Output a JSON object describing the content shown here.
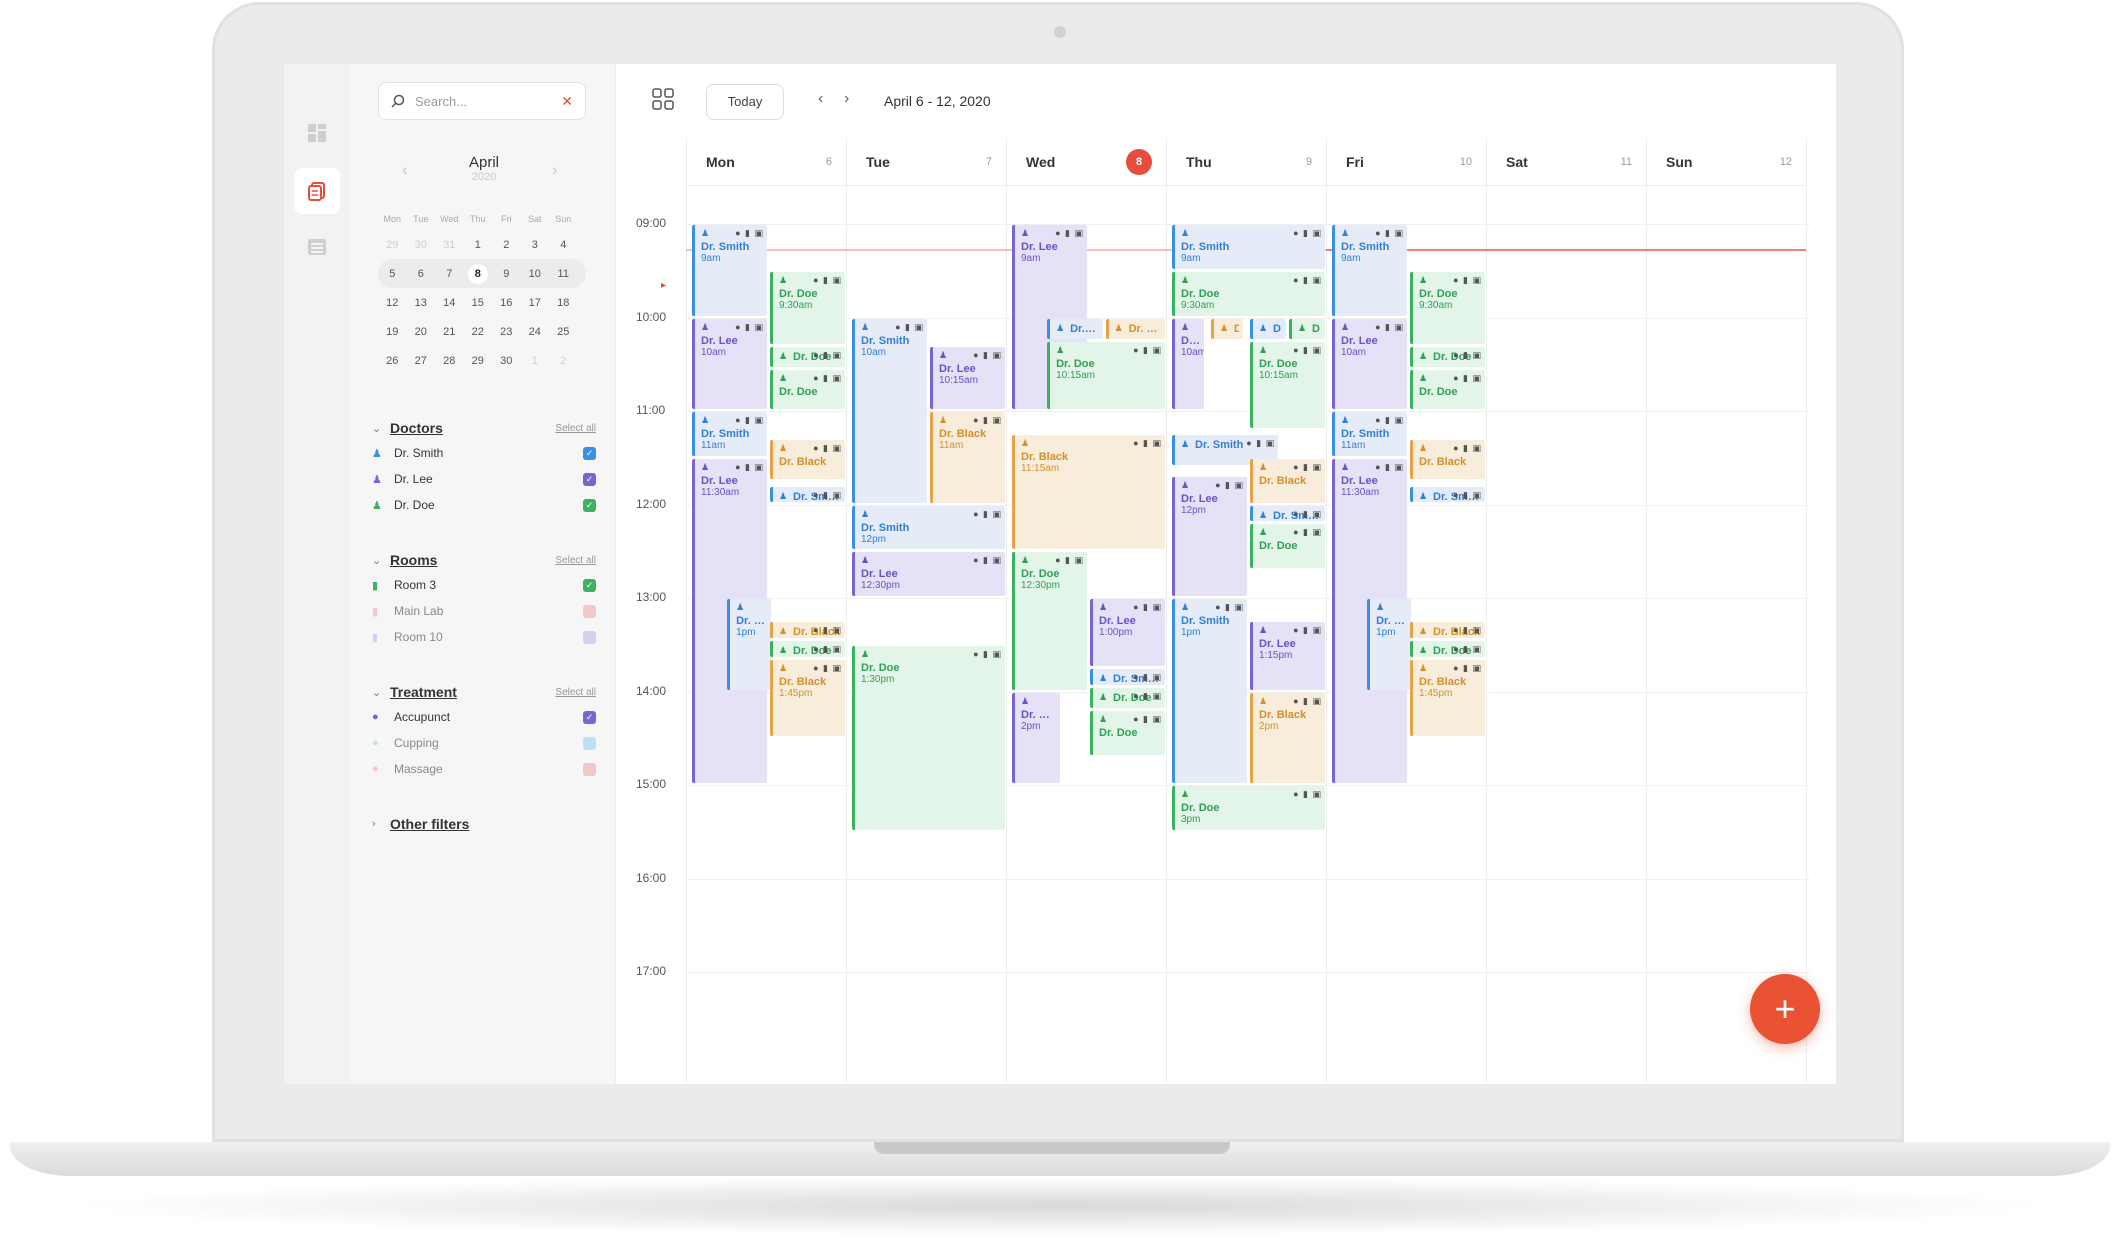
{
  "search": {
    "placeholder": "Search..."
  },
  "mini_calendar": {
    "month": "April",
    "year": "2020",
    "dow": [
      "Mon",
      "Tue",
      "Wed",
      "Thu",
      "Fri",
      "Sat",
      "Sun"
    ],
    "weeks": [
      [
        "29",
        "30",
        "31",
        "1",
        "2",
        "3",
        "4"
      ],
      [
        "5",
        "6",
        "7",
        "8",
        "9",
        "10",
        "11"
      ],
      [
        "12",
        "13",
        "14",
        "15",
        "16",
        "17",
        "18"
      ],
      [
        "19",
        "20",
        "21",
        "22",
        "23",
        "24",
        "25"
      ],
      [
        "26",
        "27",
        "28",
        "29",
        "30",
        "1",
        "2"
      ]
    ]
  },
  "filters": {
    "doctors": {
      "title": "Doctors",
      "action": "Select all",
      "items": [
        {
          "label": "Dr. Smith",
          "color": "#3a8ee6",
          "checked": true
        },
        {
          "label": "Dr. Lee",
          "color": "#7a63d2",
          "checked": true
        },
        {
          "label": "Dr. Doe",
          "color": "#3bb35e",
          "checked": true
        }
      ]
    },
    "rooms": {
      "title": "Rooms",
      "action": "Select all",
      "items": [
        {
          "label": "Room 3",
          "color": "#3bb35e",
          "checked": true
        },
        {
          "label": "Main Lab",
          "color": "#f2c7c7",
          "checked": false
        },
        {
          "label": "Room 10",
          "color": "#d6d0f0",
          "checked": false
        }
      ]
    },
    "treatment": {
      "title": "Treatment",
      "action": "Select all",
      "items": [
        {
          "label": "Accupunct",
          "color": "#7a63d2",
          "checked": true
        },
        {
          "label": "Cupping",
          "color": "#bfe0f2",
          "checked": false
        },
        {
          "label": "Massage",
          "color": "#f2c7c7",
          "checked": false
        }
      ]
    },
    "other": {
      "title": "Other filters"
    }
  },
  "toolbar": {
    "today_label": "Today",
    "range": "April 6 - 12, 2020"
  },
  "week": {
    "days": [
      {
        "name": "Mon",
        "num": "6"
      },
      {
        "name": "Tue",
        "num": "7"
      },
      {
        "name": "Wed",
        "num": "8",
        "today": true
      },
      {
        "name": "Thu",
        "num": "9"
      },
      {
        "name": "Fri",
        "num": "10"
      },
      {
        "name": "Sat",
        "num": "11"
      },
      {
        "name": "Sun",
        "num": "12"
      }
    ],
    "times": [
      "09:00",
      "10:00",
      "11:00",
      "12:00",
      "13:00",
      "14:00",
      "15:00",
      "16:00",
      "17:00"
    ]
  },
  "events": [
    {
      "day": 0,
      "col": 0,
      "cols": 1,
      "start": 9.0,
      "end": 10.0,
      "who": "Dr. Smith",
      "when": "9am",
      "color": "blue"
    },
    {
      "day": 0,
      "col": 1,
      "cols": 1,
      "start": 9.5,
      "end": 10.3,
      "who": "Dr. Doe",
      "when": "9:30am",
      "color": "green"
    },
    {
      "day": 0,
      "col": 0,
      "cols": 1,
      "start": 10.0,
      "end": 11.0,
      "who": "Dr. Lee",
      "when": "10am",
      "color": "purple"
    },
    {
      "day": 0,
      "col": 1,
      "cols": 1,
      "start": 10.3,
      "end": 10.55,
      "who": "Dr. Doe",
      "when": "",
      "color": "green"
    },
    {
      "day": 0,
      "col": 1,
      "cols": 1,
      "start": 10.55,
      "end": 11.0,
      "who": "Dr. Doe",
      "when": "",
      "color": "green"
    },
    {
      "day": 0,
      "col": 0,
      "cols": 1,
      "start": 11.0,
      "end": 11.5,
      "who": "Dr. Smith",
      "when": "11am",
      "color": "blue"
    },
    {
      "day": 0,
      "col": 1,
      "cols": 1,
      "start": 11.3,
      "end": 11.75,
      "who": "Dr. Black",
      "when": "",
      "color": "orange"
    },
    {
      "day": 0,
      "col": 0,
      "cols": 1,
      "start": 11.5,
      "end": 15.0,
      "who": "Dr. Lee",
      "when": "11:30am",
      "color": "purple"
    },
    {
      "day": 0,
      "col": 1,
      "cols": 1,
      "start": 11.8,
      "end": 12.0,
      "who": "Dr. Smith",
      "when": "",
      "color": "blue"
    },
    {
      "day": 0,
      "col": 0.45,
      "cols": 0.6,
      "start": 13.0,
      "end": 14.0,
      "who": "Dr. Smith",
      "when": "1pm",
      "color": "blue"
    },
    {
      "day": 0,
      "col": 1,
      "cols": 1,
      "start": 13.25,
      "end": 13.45,
      "who": "Dr. Black",
      "when": "",
      "color": "orange"
    },
    {
      "day": 0,
      "col": 1,
      "cols": 1,
      "start": 13.45,
      "end": 13.65,
      "who": "Dr. Doe",
      "when": "",
      "color": "green"
    },
    {
      "day": 0,
      "col": 1,
      "cols": 1,
      "start": 13.65,
      "end": 14.5,
      "who": "Dr. Black",
      "when": "1:45pm",
      "color": "orange"
    },
    {
      "day": 1,
      "col": 0,
      "cols": 1,
      "start": 10.0,
      "end": 12.0,
      "who": "Dr. Smith",
      "when": "10am",
      "color": "blue"
    },
    {
      "day": 1,
      "col": 1,
      "cols": 1,
      "start": 10.3,
      "end": 11.0,
      "who": "Dr. Lee",
      "when": "10:15am",
      "color": "purple"
    },
    {
      "day": 1,
      "col": 1,
      "cols": 1,
      "start": 11.0,
      "end": 12.0,
      "who": "Dr. Black",
      "when": "11am",
      "color": "orange"
    },
    {
      "day": 1,
      "col": 0,
      "cols": 2,
      "start": 12.0,
      "end": 12.5,
      "who": "Dr. Smith",
      "when": "12pm",
      "color": "blue"
    },
    {
      "day": 1,
      "col": 0,
      "cols": 2,
      "start": 12.5,
      "end": 13.0,
      "who": "Dr. Lee",
      "when": "12:30pm",
      "color": "purple"
    },
    {
      "day": 1,
      "col": 0,
      "cols": 2,
      "start": 13.5,
      "end": 15.5,
      "who": "Dr. Doe",
      "when": "1:30pm",
      "color": "green"
    },
    {
      "day": 2,
      "col": 0,
      "cols": 1,
      "start": 9.0,
      "end": 11.0,
      "who": "Dr. Lee",
      "when": "9am",
      "color": "purple"
    },
    {
      "day": 2,
      "col": 0.45,
      "cols": 0.75,
      "start": 10.0,
      "end": 10.25,
      "who": "Dr. Smith",
      "when": "",
      "color": "blue"
    },
    {
      "day": 2,
      "col": 1.2,
      "cols": 0.8,
      "start": 10.0,
      "end": 10.25,
      "who": "Dr. Black",
      "when": "",
      "color": "orange"
    },
    {
      "day": 2,
      "col": 0.45,
      "cols": 1.55,
      "start": 10.25,
      "end": 11.0,
      "who": "Dr. Doe",
      "when": "10:15am",
      "color": "green"
    },
    {
      "day": 2,
      "col": 0,
      "cols": 2,
      "start": 11.25,
      "end": 12.5,
      "who": "Dr. Black",
      "when": "11:15am",
      "color": "orange"
    },
    {
      "day": 2,
      "col": 0,
      "cols": 1,
      "start": 12.5,
      "end": 14.0,
      "who": "Dr. Doe",
      "when": "12:30pm",
      "color": "green"
    },
    {
      "day": 2,
      "col": 1,
      "cols": 1,
      "start": 13.0,
      "end": 13.75,
      "who": "Dr. Lee",
      "when": "1:00pm",
      "color": "purple"
    },
    {
      "day": 2,
      "col": 1,
      "cols": 1,
      "start": 13.75,
      "end": 13.95,
      "who": "Dr. Smith",
      "when": "",
      "color": "blue"
    },
    {
      "day": 2,
      "col": 1,
      "cols": 1,
      "start": 13.95,
      "end": 14.2,
      "who": "Dr. Doe",
      "when": "",
      "color": "green"
    },
    {
      "day": 2,
      "col": 0,
      "cols": 0.65,
      "start": 14.0,
      "end": 15.0,
      "who": "Dr. Lee",
      "when": "2pm",
      "color": "purple"
    },
    {
      "day": 2,
      "col": 1,
      "cols": 1,
      "start": 14.2,
      "end": 14.7,
      "who": "Dr. Doe",
      "when": "",
      "color": "green"
    },
    {
      "day": 3,
      "col": 0,
      "cols": 2,
      "start": 9.0,
      "end": 9.5,
      "who": "Dr. Smith",
      "when": "9am",
      "color": "blue"
    },
    {
      "day": 3,
      "col": 0,
      "cols": 2,
      "start": 9.5,
      "end": 10.0,
      "who": "Dr. Doe",
      "when": "9:30am",
      "color": "green"
    },
    {
      "day": 3,
      "col": 0,
      "cols": 0.45,
      "start": 10.0,
      "end": 11.0,
      "who": "Dr. Lee",
      "when": "10am",
      "color": "purple"
    },
    {
      "day": 3,
      "col": 0.5,
      "cols": 0.45,
      "start": 10.0,
      "end": 10.25,
      "who": "Dr....",
      "when": "",
      "color": "orange"
    },
    {
      "day": 3,
      "col": 1.0,
      "cols": 0.5,
      "start": 10.0,
      "end": 10.25,
      "who": "Dr....",
      "when": "",
      "color": "blue"
    },
    {
      "day": 3,
      "col": 1.5,
      "cols": 0.5,
      "start": 10.0,
      "end": 10.25,
      "who": "Dr....",
      "when": "",
      "color": "green"
    },
    {
      "day": 3,
      "col": 1.0,
      "cols": 1.0,
      "start": 10.25,
      "end": 11.2,
      "who": "Dr. Doe",
      "when": "10:15am",
      "color": "green"
    },
    {
      "day": 3,
      "col": 0,
      "cols": 1.4,
      "start": 11.25,
      "end": 11.6,
      "who": "Dr. Smith",
      "when": "",
      "color": "blue"
    },
    {
      "day": 3,
      "col": 1,
      "cols": 1,
      "start": 11.5,
      "end": 12.0,
      "who": "Dr. Black",
      "when": "",
      "color": "orange"
    },
    {
      "day": 3,
      "col": 0,
      "cols": 1,
      "start": 11.7,
      "end": 13.0,
      "who": "Dr. Lee",
      "when": "12pm",
      "color": "purple"
    },
    {
      "day": 3,
      "col": 1,
      "cols": 1,
      "start": 12.0,
      "end": 12.2,
      "who": "Dr. Smith",
      "when": "",
      "color": "blue"
    },
    {
      "day": 3,
      "col": 1,
      "cols": 1,
      "start": 12.2,
      "end": 12.7,
      "who": "Dr. Doe",
      "when": "",
      "color": "green"
    },
    {
      "day": 3,
      "col": 0,
      "cols": 1,
      "start": 13.0,
      "end": 15.0,
      "who": "Dr. Smith",
      "when": "1pm",
      "color": "blue"
    },
    {
      "day": 3,
      "col": 1,
      "cols": 1,
      "start": 13.25,
      "end": 14.0,
      "who": "Dr. Lee",
      "when": "1:15pm",
      "color": "purple"
    },
    {
      "day": 3,
      "col": 1,
      "cols": 1,
      "start": 14.0,
      "end": 15.0,
      "who": "Dr. Black",
      "when": "2pm",
      "color": "orange"
    },
    {
      "day": 3,
      "col": 0,
      "cols": 2,
      "start": 15.0,
      "end": 15.5,
      "who": "Dr. Doe",
      "when": "3pm",
      "color": "green"
    },
    {
      "day": 4,
      "col": 0,
      "cols": 1,
      "start": 9.0,
      "end": 10.0,
      "who": "Dr. Smith",
      "when": "9am",
      "color": "blue"
    },
    {
      "day": 4,
      "col": 1,
      "cols": 1,
      "start": 9.5,
      "end": 10.3,
      "who": "Dr. Doe",
      "when": "9:30am",
      "color": "green"
    },
    {
      "day": 4,
      "col": 0,
      "cols": 1,
      "start": 10.0,
      "end": 11.0,
      "who": "Dr. Lee",
      "when": "10am",
      "color": "purple"
    },
    {
      "day": 4,
      "col": 1,
      "cols": 1,
      "start": 10.3,
      "end": 10.55,
      "who": "Dr. Doe",
      "when": "",
      "color": "green"
    },
    {
      "day": 4,
      "col": 1,
      "cols": 1,
      "start": 10.55,
      "end": 11.0,
      "who": "Dr. Doe",
      "when": "",
      "color": "green"
    },
    {
      "day": 4,
      "col": 0,
      "cols": 1,
      "start": 11.0,
      "end": 11.5,
      "who": "Dr. Smith",
      "when": "11am",
      "color": "blue"
    },
    {
      "day": 4,
      "col": 1,
      "cols": 1,
      "start": 11.3,
      "end": 11.75,
      "who": "Dr. Black",
      "when": "",
      "color": "orange"
    },
    {
      "day": 4,
      "col": 0,
      "cols": 1,
      "start": 11.5,
      "end": 15.0,
      "who": "Dr. Lee",
      "when": "11:30am",
      "color": "purple"
    },
    {
      "day": 4,
      "col": 1,
      "cols": 1,
      "start": 11.8,
      "end": 12.0,
      "who": "Dr. Smith",
      "when": "",
      "color": "blue"
    },
    {
      "day": 4,
      "col": 0.45,
      "cols": 0.6,
      "start": 13.0,
      "end": 14.0,
      "who": "Dr. Smith",
      "when": "1pm",
      "color": "blue"
    },
    {
      "day": 4,
      "col": 1,
      "cols": 1,
      "start": 13.25,
      "end": 13.45,
      "who": "Dr. Black",
      "when": "",
      "color": "orange"
    },
    {
      "day": 4,
      "col": 1,
      "cols": 1,
      "start": 13.45,
      "end": 13.65,
      "who": "Dr. Doe",
      "when": "",
      "color": "green"
    },
    {
      "day": 4,
      "col": 1,
      "cols": 1,
      "start": 13.65,
      "end": 14.5,
      "who": "Dr. Black",
      "when": "1:45pm",
      "color": "orange"
    }
  ],
  "icons": {
    "search": "search-icon",
    "clear": "close-icon",
    "grid": "grid-view-icon",
    "prev": "chevron-left-icon",
    "next": "chevron-right-icon",
    "add": "plus-icon",
    "person": "person-icon"
  },
  "colors": {
    "accent": "#e84c3d",
    "blue": "#3a8ee6",
    "purple": "#7a63d2",
    "green": "#3bb35e",
    "orange": "#e5a44a"
  }
}
